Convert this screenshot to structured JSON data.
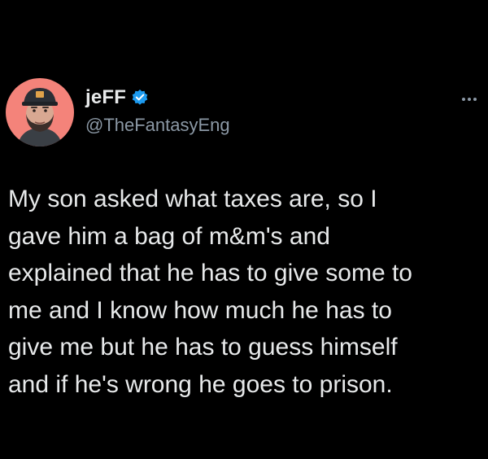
{
  "author": {
    "display_name": "jeFF",
    "handle": "@TheFantasyEng",
    "verified": true,
    "avatar_icon": "profile-photo-man-with-cap-icon",
    "verified_icon": "verified-badge-icon",
    "verified_color": "#1d9bf0"
  },
  "menu": {
    "icon": "more-options-icon"
  },
  "tweet": {
    "lines": [
      "My son asked what taxes are, so I",
      "gave him a bag of m&m's and",
      "explained that he has to give some to",
      "me and I know how much he has to",
      "give me but he has to guess himself",
      "and if he's wrong he goes to prison."
    ]
  },
  "colors": {
    "background": "#000000",
    "text": "#e7e9ea",
    "secondary_text": "#8b98a5",
    "avatar_bg": "#f4837a"
  }
}
